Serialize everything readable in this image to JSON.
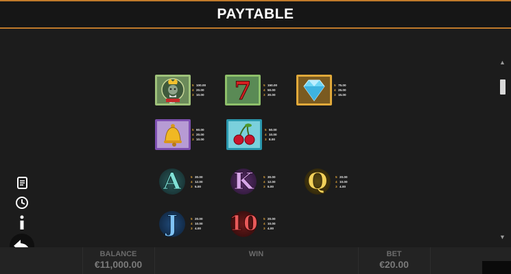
{
  "header": {
    "title": "PAYTABLE"
  },
  "symbols": {
    "king": {
      "icon": "king-icon",
      "banner": "WILD",
      "pays": [
        {
          "n": "5",
          "v": "100.00"
        },
        {
          "n": "4",
          "v": "20.00"
        },
        {
          "n": "3",
          "v": "10.00"
        }
      ]
    },
    "seven": {
      "icon": "seven-icon",
      "glyph": "7",
      "pays": [
        {
          "n": "5",
          "v": "150.00"
        },
        {
          "n": "4",
          "v": "50.00"
        },
        {
          "n": "3",
          "v": "30.00"
        }
      ]
    },
    "diamond": {
      "icon": "diamond-icon",
      "pays": [
        {
          "n": "5",
          "v": "75.00"
        },
        {
          "n": "4",
          "v": "25.00"
        },
        {
          "n": "3",
          "v": "15.00"
        }
      ]
    },
    "bell": {
      "icon": "bell-icon",
      "pays": [
        {
          "n": "5",
          "v": "60.00"
        },
        {
          "n": "4",
          "v": "20.00"
        },
        {
          "n": "3",
          "v": "10.00"
        }
      ]
    },
    "cherry": {
      "icon": "cherry-icon",
      "pays": [
        {
          "n": "5",
          "v": "50.00"
        },
        {
          "n": "4",
          "v": "10.00"
        },
        {
          "n": "3",
          "v": "8.00"
        }
      ]
    },
    "A": {
      "glyph": "A",
      "pays": [
        {
          "n": "5",
          "v": "30.00"
        },
        {
          "n": "4",
          "v": "12.00"
        },
        {
          "n": "3",
          "v": "5.00"
        }
      ]
    },
    "K": {
      "glyph": "K",
      "pays": [
        {
          "n": "5",
          "v": "30.00"
        },
        {
          "n": "4",
          "v": "12.00"
        },
        {
          "n": "3",
          "v": "5.00"
        }
      ]
    },
    "Q": {
      "glyph": "Q",
      "pays": [
        {
          "n": "5",
          "v": "20.00"
        },
        {
          "n": "4",
          "v": "10.00"
        },
        {
          "n": "3",
          "v": "4.00"
        }
      ]
    },
    "J": {
      "glyph": "J",
      "pays": [
        {
          "n": "5",
          "v": "20.00"
        },
        {
          "n": "4",
          "v": "10.00"
        },
        {
          "n": "3",
          "v": "4.00"
        }
      ]
    },
    "10": {
      "glyph": "10",
      "pays": [
        {
          "n": "5",
          "v": "20.00"
        },
        {
          "n": "4",
          "v": "10.00"
        },
        {
          "n": "3",
          "v": "4.00"
        }
      ]
    }
  },
  "sidebar": {
    "icons": [
      "paytable-scroll-icon",
      "history-icon",
      "info-icon",
      "back-arrow-icon"
    ]
  },
  "footer": {
    "balance_label": "BALANCE",
    "balance_value": "€11,000.00",
    "win_label": "WIN",
    "bet_label": "BET",
    "bet_value": "€20.00"
  },
  "colors": {
    "accent": "#c07a2a",
    "pay_count": "#e0a43a",
    "background": "#1c1c1c"
  }
}
